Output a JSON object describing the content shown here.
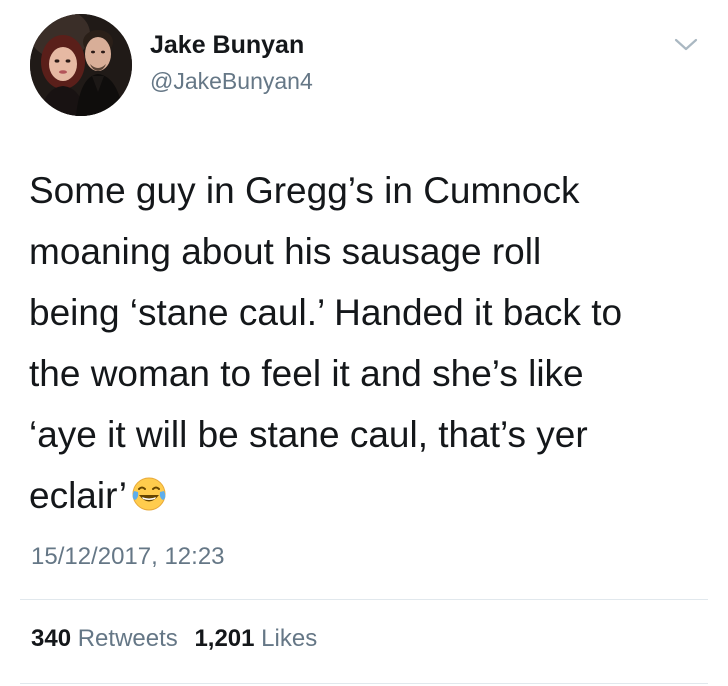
{
  "user": {
    "display_name": "Jake Bunyan",
    "handle": "@JakeBunyan4"
  },
  "icons": {
    "menu": "chevron-down-icon",
    "emoji": "face-with-tears-of-joy-icon"
  },
  "tweet": {
    "lines": [
      "Some guy in Gregg’s in Cumnock",
      "moaning about his sausage roll",
      "being ‘stane caul.’ Handed it back to",
      "the woman to feel it and she’s like",
      "‘aye it will be stane caul, that’s yer",
      "eclair’"
    ],
    "timestamp": "15/12/2017, 12:23"
  },
  "stats": {
    "retweets_count": "340",
    "retweets_label": "Retweets",
    "likes_count": "1,201",
    "likes_label": "Likes"
  },
  "colors": {
    "text": "#14171a",
    "secondary": "#657786",
    "divider": "#e1e8ed"
  }
}
